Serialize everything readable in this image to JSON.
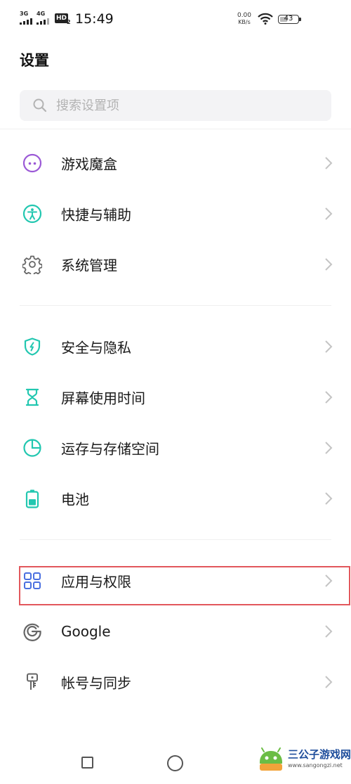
{
  "status_bar": {
    "sim1_label": "3G",
    "sim2_label": "4G",
    "hd_label": "HD",
    "hd_sub": "2",
    "time": "15:49",
    "net_speed_value": "0.00",
    "net_speed_unit": "KB/s",
    "battery_level": "43",
    "battery_fraction": 0.43
  },
  "header": {
    "title": "设置",
    "search_placeholder": "搜索设置项"
  },
  "sections": [
    {
      "items": [
        {
          "label": "游戏魔盒",
          "icon": "game-box-icon"
        },
        {
          "label": "快捷与辅助",
          "icon": "accessibility-icon"
        },
        {
          "label": "系统管理",
          "icon": "gear-icon"
        }
      ]
    },
    {
      "items": [
        {
          "label": "安全与隐私",
          "icon": "shield-icon"
        },
        {
          "label": "屏幕使用时间",
          "icon": "hourglass-icon"
        },
        {
          "label": "运存与存储空间",
          "icon": "storage-pie-icon"
        },
        {
          "label": "电池",
          "icon": "battery-icon"
        }
      ]
    },
    {
      "items": [
        {
          "label": "应用与权限",
          "icon": "apps-grid-icon",
          "highlighted": true
        },
        {
          "label": "Google",
          "icon": "google-icon"
        },
        {
          "label": "帐号与同步",
          "icon": "account-key-icon"
        }
      ]
    }
  ],
  "watermark": {
    "title": "三公子游戏网",
    "url": "www.sangongzi.net"
  },
  "colors": {
    "purple": "#9b59d6",
    "teal": "#22c7b0",
    "blue": "#4a6fe0",
    "gray_icon": "#666666",
    "highlight_border": "#e2575c",
    "search_bg": "#f3f3f5"
  }
}
